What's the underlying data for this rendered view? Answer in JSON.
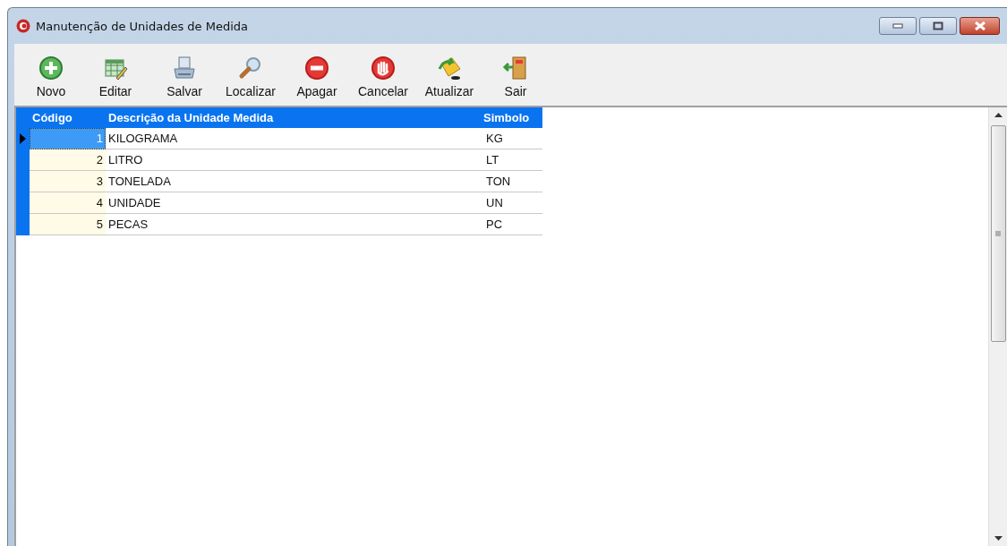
{
  "window": {
    "title": "Manutenção de Unidades de Medida"
  },
  "toolbar": [
    {
      "label": "Novo",
      "kind": "add"
    },
    {
      "label": "Editar",
      "kind": "edit"
    },
    {
      "label": "Salvar",
      "kind": "save"
    },
    {
      "label": "Localizar",
      "kind": "find"
    },
    {
      "label": "Apagar",
      "kind": "delete"
    },
    {
      "label": "Cancelar",
      "kind": "cancel"
    },
    {
      "label": "Atualizar",
      "kind": "refresh"
    },
    {
      "label": "Sair",
      "kind": "exit"
    }
  ],
  "table": {
    "columns": [
      "Código",
      "Descrição da Unidade Medida",
      "Simbolo"
    ],
    "rows": [
      {
        "cells": [
          "1",
          "KILOGRAMA",
          "KG"
        ],
        "selected": true
      },
      {
        "cells": [
          "2",
          "LITRO",
          "LT"
        ],
        "selected": false
      },
      {
        "cells": [
          "3",
          "TONELADA",
          "TON"
        ],
        "selected": false
      },
      {
        "cells": [
          "4",
          "UNIDADE",
          "UN"
        ],
        "selected": false
      },
      {
        "cells": [
          "5",
          "PECAS",
          "PC"
        ],
        "selected": false
      }
    ]
  }
}
